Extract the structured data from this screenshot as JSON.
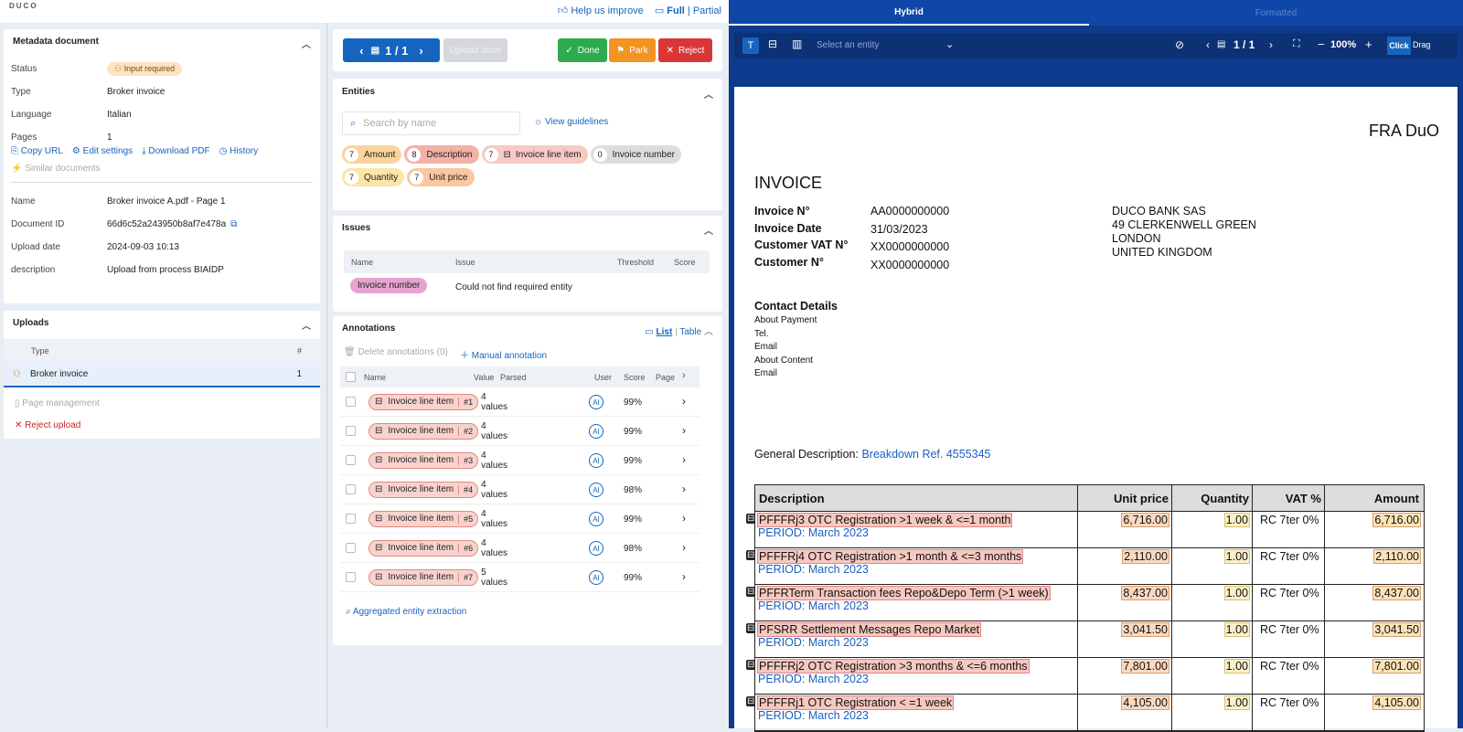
{
  "topbar": {
    "logo": "DUCO",
    "help": "Help us improve",
    "full": "Full",
    "sep": "|",
    "partial": "Partial"
  },
  "metadata": {
    "title": "Metadata document",
    "rows": [
      {
        "k": "Status",
        "v": "Input required"
      },
      {
        "k": "Type",
        "v": "Broker invoice"
      },
      {
        "k": "Language",
        "v": "Italian"
      },
      {
        "k": "Pages",
        "v": "1"
      }
    ],
    "links": {
      "copy": "Copy URL",
      "edit": "Edit settings",
      "download": "Download PDF",
      "history": "History",
      "similar": "Similar documents"
    },
    "rows2": [
      {
        "k": "Name",
        "v": "Broker invoice A.pdf - Page 1"
      },
      {
        "k": "Document ID",
        "v": "66d6c52a243950b8af7e478a"
      },
      {
        "k": "Upload date",
        "v": "2024-09-03 10:13"
      },
      {
        "k": "description",
        "v": "Upload from process BIAIDP"
      }
    ]
  },
  "uploads": {
    "title": "Uploads",
    "col_type": "Type",
    "col_num": "#",
    "item": "Broker invoice",
    "item_count": "1",
    "page_mgmt": "Page management",
    "reject": "Reject upload"
  },
  "toolbar": {
    "pager": "1 / 1",
    "upload_done": "Upload done",
    "done": "Done",
    "park": "Park",
    "reject": "Reject"
  },
  "entities": {
    "title": "Entities",
    "search_placeholder": "Search by name",
    "guidelines": "View guidelines",
    "chips": [
      {
        "n": "7",
        "label": "Amount",
        "bg": "#fbd49b"
      },
      {
        "n": "8",
        "label": "Description",
        "bg": "#f4b1a6"
      },
      {
        "n": "7",
        "label": "Invoice line item",
        "bg": "#f8c9c3"
      },
      {
        "n": "0",
        "label": "Invoice number",
        "bg": "#dddddd"
      },
      {
        "n": "7",
        "label": "Quantity",
        "bg": "#fbe6a8"
      },
      {
        "n": "7",
        "label": "Unit price",
        "bg": "#fac7a0"
      }
    ]
  },
  "issues": {
    "title": "Issues",
    "cols": [
      "Name",
      "Issue",
      "Threshold",
      "Score"
    ],
    "row": {
      "name": "Invoice number",
      "issue": "Could not find required entity"
    }
  },
  "annotations": {
    "title": "Annotations",
    "view_list": "List",
    "view_sep": "|",
    "view_table": "Table",
    "delete": "Delete annotations (0)",
    "manual": "Manual annotation",
    "cols": [
      "Name",
      "Value",
      "Parsed",
      "User",
      "Score",
      "Page"
    ],
    "rows": [
      {
        "label": "Invoice line item",
        "num": "#1",
        "count": "4",
        "unit": "values",
        "user": "AI",
        "score": "99%"
      },
      {
        "label": "Invoice line item",
        "num": "#2",
        "count": "4",
        "unit": "values",
        "user": "AI",
        "score": "99%"
      },
      {
        "label": "Invoice line item",
        "num": "#3",
        "count": "4",
        "unit": "values",
        "user": "AI",
        "score": "99%"
      },
      {
        "label": "Invoice line item",
        "num": "#4",
        "count": "4",
        "unit": "values",
        "user": "AI",
        "score": "98%"
      },
      {
        "label": "Invoice line item",
        "num": "#5",
        "count": "4",
        "unit": "values",
        "user": "AI",
        "score": "99%"
      },
      {
        "label": "Invoice line item",
        "num": "#6",
        "count": "4",
        "unit": "values",
        "user": "AI",
        "score": "98%"
      },
      {
        "label": "Invoice line item",
        "num": "#7",
        "count": "5",
        "unit": "values",
        "user": "AI",
        "score": "99%"
      }
    ],
    "aggregated": "Aggregated entity extraction"
  },
  "viewer": {
    "tab_hybrid": "Hybrid",
    "tab_formatted": "Formatted",
    "entity_select": "Select an entity",
    "pager": "1 / 1",
    "zoom": "100%",
    "click": "Click",
    "drag": "Drag"
  },
  "doc": {
    "company": "FRA DuO",
    "heading": "INVOICE",
    "fields": [
      {
        "k": "Invoice N°",
        "v": "AA0000000000"
      },
      {
        "k": "Invoice Date",
        "v": "31/03/2023"
      },
      {
        "k": "Customer VAT N°",
        "v": "XX0000000000"
      },
      {
        "k": "Customer N°",
        "v": "XX0000000000"
      }
    ],
    "address": [
      "DUCO BANK SAS",
      "49 CLERKENWELL GREEN",
      "LONDON",
      "UNITED KINGDOM"
    ],
    "contact_title": "Contact Details",
    "contact": [
      "About Payment",
      "Tel.",
      "Email",
      "About Content",
      "Email"
    ],
    "general_label": "General Description:",
    "general_value": "Breakdown Ref. 4555345",
    "table_head": [
      "Description",
      "Unit price",
      "Quantity",
      "VAT %",
      "Amount"
    ],
    "lines": [
      {
        "desc": "PFFFRj3 OTC Registration >1 week & <=1 month",
        "period": "PERIOD: March 2023",
        "price": "6,716.00",
        "qty": "1.00",
        "vat": "RC 7ter 0%",
        "amt": "6,716.00"
      },
      {
        "desc": "PFFFRj4 OTC Registration >1 month & <=3 months",
        "period": "PERIOD: March 2023",
        "price": "2,110.00",
        "qty": "1.00",
        "vat": "RC 7ter 0%",
        "amt": "2,110.00"
      },
      {
        "desc": "PFFRTerm Transaction fees Repo&Depo Term (>1 week)",
        "period": "PERIOD: March 2023",
        "price": "8,437.00",
        "qty": "1.00",
        "vat": "RC 7ter 0%",
        "amt": "8,437.00"
      },
      {
        "desc": "PFSRR Settlement Messages Repo Market",
        "period": "PERIOD: March 2023",
        "price": "3,041.50",
        "qty": "1.00",
        "vat": "RC 7ter 0%",
        "amt": "3,041.50"
      },
      {
        "desc": "PFFFRj2 OTC Registration >3 months & <=6 months",
        "period": "PERIOD: March 2023",
        "price": "7,801.00",
        "qty": "1.00",
        "vat": "RC 7ter 0%",
        "amt": "7,801.00"
      },
      {
        "desc": "PFFFRj1 OTC Registration < =1 week",
        "period": "PERIOD: March 2023",
        "price": "4,105.00",
        "qty": "1.00",
        "vat": "RC 7ter 0%",
        "amt": "4,105.00"
      }
    ]
  },
  "colors": {
    "primary": "#1565c0",
    "done": "#2eaa4f",
    "park": "#f29322",
    "reject": "#d93737",
    "viewer_bg": "#0d3a8c"
  }
}
